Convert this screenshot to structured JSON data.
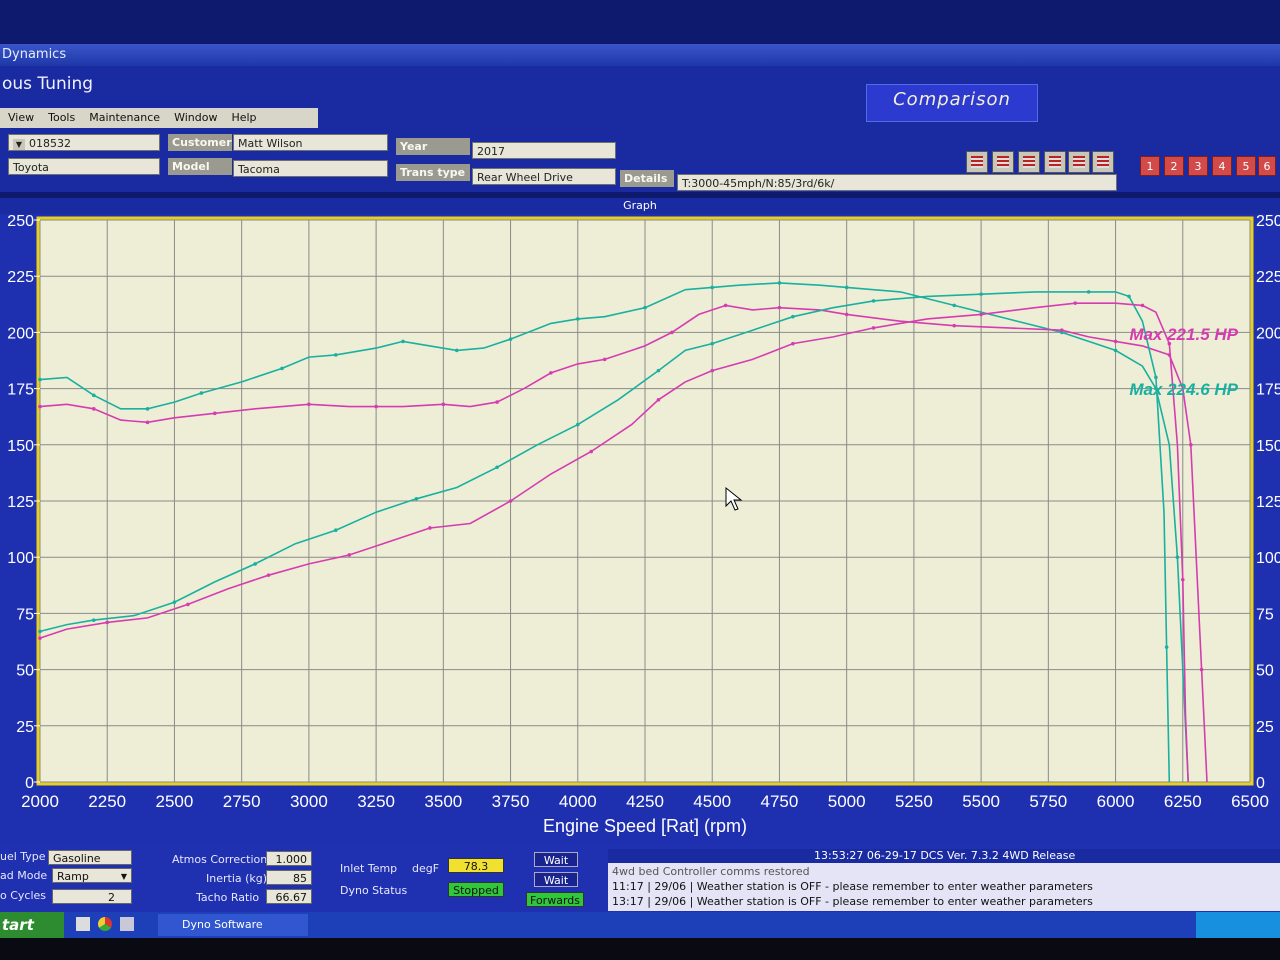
{
  "window": {
    "title": "Dynamics",
    "app_title": "ous Tuning"
  },
  "menu": [
    "View",
    "Tools",
    "Maintenance",
    "Window",
    "Help"
  ],
  "comparison_label": "Comparison",
  "fields": {
    "id_value": "018532",
    "make_value": "Toyota",
    "customer_label": "Customer",
    "customer_value": "Matt Wilson",
    "model_label": "Model",
    "model_value": "Tacoma",
    "year_label": "Year",
    "year_value": "2017",
    "trans_label": "Trans type",
    "trans_value": "Rear Wheel Drive",
    "details_label": "Details",
    "details_value": "T:3000-45mph/N:85/3rd/6k/"
  },
  "run_buttons": [
    "1",
    "2",
    "3",
    "4",
    "5",
    "6"
  ],
  "graph_label": "Graph",
  "chart_data": {
    "type": "line",
    "xlabel": "Engine Speed [Rat] (rpm)",
    "xlim": [
      2000,
      6500
    ],
    "ylim": [
      0,
      250
    ],
    "x_ticks": [
      "2000",
      "2250",
      "2500",
      "2750",
      "3000",
      "3250",
      "3500",
      "3750",
      "4000",
      "4250",
      "4500",
      "4750",
      "5000",
      "5250",
      "5500",
      "5750",
      "6000",
      "6250",
      "6500"
    ],
    "y_ticks_left": [
      "0",
      "25",
      "50",
      "75",
      "100",
      "125",
      "150",
      "175",
      "200",
      "225",
      "250"
    ],
    "y_ticks_right": [
      "0",
      "25",
      "50",
      "75",
      "100",
      "125",
      "150",
      "175",
      "200",
      "225",
      "250"
    ],
    "grid": true,
    "colors": {
      "teal": "#19b0a0",
      "magenta": "#d63cb0"
    },
    "annotations": [
      {
        "text": "Max 221.5 HP",
        "color": "#d63cb0"
      },
      {
        "text": "Max 224.6 HP",
        "color": "#19b0a0"
      }
    ],
    "series": [
      {
        "color": "#19b0a0",
        "points": [
          [
            2000,
            179
          ],
          [
            2100,
            180
          ],
          [
            2200,
            172
          ],
          [
            2300,
            166
          ],
          [
            2400,
            166
          ],
          [
            2500,
            169
          ],
          [
            2600,
            173
          ],
          [
            2750,
            178
          ],
          [
            2900,
            184
          ],
          [
            3000,
            189
          ],
          [
            3100,
            190
          ],
          [
            3250,
            193
          ],
          [
            3350,
            196
          ],
          [
            3450,
            194
          ],
          [
            3550,
            192
          ],
          [
            3650,
            193
          ],
          [
            3750,
            197
          ],
          [
            3900,
            204
          ],
          [
            4000,
            206
          ],
          [
            4100,
            207
          ],
          [
            4250,
            211
          ],
          [
            4400,
            219
          ],
          [
            4500,
            220
          ],
          [
            4600,
            221
          ],
          [
            4750,
            222
          ],
          [
            4900,
            221
          ],
          [
            5000,
            220
          ],
          [
            5200,
            218
          ],
          [
            5400,
            212
          ],
          [
            5600,
            206
          ],
          [
            5800,
            200
          ],
          [
            5900,
            196
          ],
          [
            6000,
            192
          ],
          [
            6100,
            185
          ],
          [
            6150,
            175
          ],
          [
            6200,
            150
          ],
          [
            6230,
            100
          ],
          [
            6250,
            50
          ],
          [
            6270,
            0
          ]
        ]
      },
      {
        "color": "#d63cb0",
        "points": [
          [
            2000,
            167
          ],
          [
            2100,
            168
          ],
          [
            2200,
            166
          ],
          [
            2300,
            161
          ],
          [
            2400,
            160
          ],
          [
            2500,
            162
          ],
          [
            2650,
            164
          ],
          [
            2800,
            166
          ],
          [
            3000,
            168
          ],
          [
            3150,
            167
          ],
          [
            3250,
            167
          ],
          [
            3350,
            167
          ],
          [
            3500,
            168
          ],
          [
            3600,
            167
          ],
          [
            3700,
            169
          ],
          [
            3800,
            175
          ],
          [
            3900,
            182
          ],
          [
            4000,
            186
          ],
          [
            4100,
            188
          ],
          [
            4250,
            194
          ],
          [
            4350,
            200
          ],
          [
            4450,
            208
          ],
          [
            4550,
            212
          ],
          [
            4650,
            210
          ],
          [
            4750,
            211
          ],
          [
            4900,
            210
          ],
          [
            5000,
            208
          ],
          [
            5200,
            205
          ],
          [
            5400,
            203
          ],
          [
            5600,
            202
          ],
          [
            5800,
            201
          ],
          [
            5900,
            198
          ],
          [
            6000,
            196
          ],
          [
            6100,
            194
          ],
          [
            6200,
            190
          ],
          [
            6250,
            175
          ],
          [
            6280,
            150
          ],
          [
            6300,
            100
          ],
          [
            6320,
            50
          ],
          [
            6340,
            0
          ]
        ]
      },
      {
        "color": "#19b0a0",
        "points": [
          [
            2000,
            67
          ],
          [
            2100,
            70
          ],
          [
            2200,
            72
          ],
          [
            2350,
            74
          ],
          [
            2500,
            80
          ],
          [
            2650,
            89
          ],
          [
            2800,
            97
          ],
          [
            2950,
            106
          ],
          [
            3100,
            112
          ],
          [
            3250,
            120
          ],
          [
            3400,
            126
          ],
          [
            3550,
            131
          ],
          [
            3700,
            140
          ],
          [
            3850,
            150
          ],
          [
            4000,
            159
          ],
          [
            4150,
            170
          ],
          [
            4300,
            183
          ],
          [
            4400,
            192
          ],
          [
            4500,
            195
          ],
          [
            4650,
            201
          ],
          [
            4800,
            207
          ],
          [
            4950,
            211
          ],
          [
            5100,
            214
          ],
          [
            5300,
            216
          ],
          [
            5500,
            217
          ],
          [
            5700,
            218
          ],
          [
            5900,
            218
          ],
          [
            6000,
            218
          ],
          [
            6050,
            216
          ],
          [
            6100,
            205
          ],
          [
            6150,
            180
          ],
          [
            6180,
            120
          ],
          [
            6190,
            60
          ],
          [
            6200,
            0
          ]
        ]
      },
      {
        "color": "#d63cb0",
        "points": [
          [
            2000,
            64
          ],
          [
            2100,
            68
          ],
          [
            2250,
            71
          ],
          [
            2400,
            73
          ],
          [
            2550,
            79
          ],
          [
            2700,
            86
          ],
          [
            2850,
            92
          ],
          [
            3000,
            97
          ],
          [
            3150,
            101
          ],
          [
            3300,
            107
          ],
          [
            3450,
            113
          ],
          [
            3600,
            115
          ],
          [
            3750,
            125
          ],
          [
            3900,
            137
          ],
          [
            4050,
            147
          ],
          [
            4200,
            159
          ],
          [
            4300,
            170
          ],
          [
            4400,
            178
          ],
          [
            4500,
            183
          ],
          [
            4650,
            188
          ],
          [
            4800,
            195
          ],
          [
            4950,
            198
          ],
          [
            5100,
            202
          ],
          [
            5300,
            206
          ],
          [
            5500,
            208
          ],
          [
            5700,
            211
          ],
          [
            5850,
            213
          ],
          [
            6000,
            213
          ],
          [
            6100,
            212
          ],
          [
            6150,
            209
          ],
          [
            6200,
            195
          ],
          [
            6230,
            150
          ],
          [
            6250,
            90
          ],
          [
            6260,
            30
          ],
          [
            6270,
            0
          ]
        ]
      }
    ]
  },
  "bottom": {
    "fuel_type_label": "uel Type",
    "fuel_type_value": "Gasoline",
    "load_mode_label": "ad Mode",
    "load_mode_value": "Ramp",
    "cycles_label": "o Cycles",
    "cycles_value": "2",
    "atmos_label": "Atmos Correction",
    "atmos_value": "1.000",
    "inertia_label": "Inertia (kg)",
    "inertia_value": "85",
    "tacho_label": "Tacho Ratio",
    "tacho_value": "66.67",
    "inlet_label": "Inlet Temp",
    "inlet_unit": "degF",
    "inlet_value": "78.3",
    "dyno_status_label": "Dyno Status",
    "dyno_status_value": "Stopped",
    "wait1": "Wait",
    "wait2": "Wait",
    "forwards": "Forwards",
    "log_header": "13:53:27    06-29-17  DCS Ver.  7.3.2 4WD Release",
    "log_lines": [
      "4wd bed Controller comms restored",
      "11:17 | 29/06 | Weather station is OFF - please remember to enter weather parameters",
      "13:17 | 29/06 | Weather station is OFF - please remember to enter weather parameters"
    ]
  },
  "taskbar": {
    "start": "tart",
    "item": "Dyno Software"
  }
}
